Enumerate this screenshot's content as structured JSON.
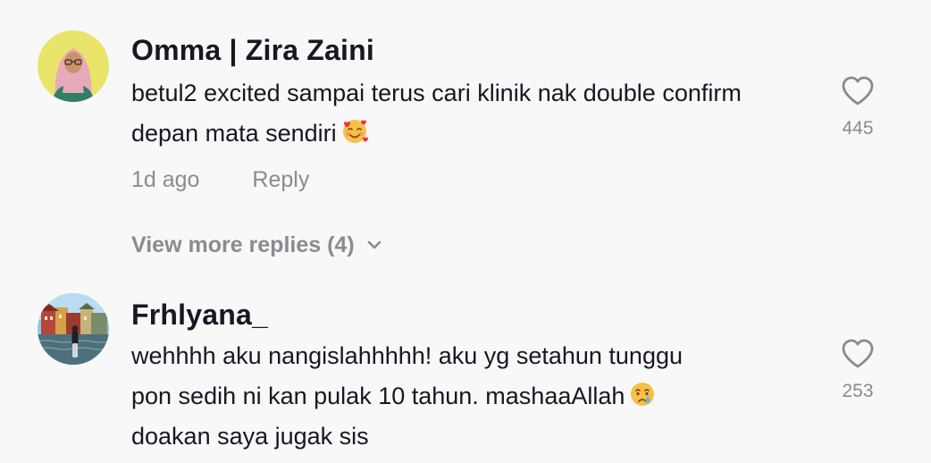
{
  "comments": [
    {
      "username": "Omma | Zira Zaini",
      "text": "betul2 excited sampai terus cari klinik nak double confirm depan mata sendiri",
      "emoji": "smiling-face-with-hearts-emoji",
      "time": "1d ago",
      "reply_label": "Reply",
      "view_more": "View more replies (4)",
      "likes": "445",
      "avatar": "avatar-woman-hijab-yellow-background"
    },
    {
      "username": "Frhlyana_",
      "text_lines": [
        "wehhhh aku nangislahhhhh! aku yg setahun tunggu",
        "pon sedih ni kan pulak 10 tahun. mashaaAllah",
        "doakan saya jugak sis"
      ],
      "emoji": "crying-face-emoji",
      "likes": "253",
      "avatar": "avatar-photo-waterfront"
    }
  ],
  "colors": {
    "background": "#f8f8f8",
    "primary_text": "#161823",
    "secondary_text": "#8a8b91"
  }
}
